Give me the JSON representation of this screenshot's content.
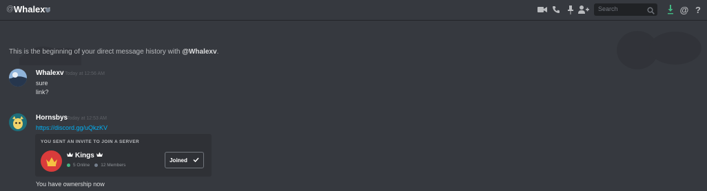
{
  "header": {
    "title": "Whalexv",
    "search_placeholder": "Search",
    "icons": [
      "at-icon",
      "video-call-icon",
      "voice-call-icon",
      "pin-icon",
      "add-friend-icon",
      "search-icon",
      "download-icon",
      "mentions-icon",
      "help-icon"
    ]
  },
  "intro": {
    "text_before": "This is the beginning of your direct message history with ",
    "mention": "@Whalexv",
    "text_after": "."
  },
  "messages": [
    {
      "author": "Whalexv",
      "timestamp": "Today at 12:56 AM",
      "lines": [
        "sure",
        "link?"
      ]
    },
    {
      "author": "Hornsbys",
      "timestamp": "Today at 12:53 AM",
      "link": "https://discord.gg/uQkzKV",
      "invite": {
        "header": "YOU SENT AN INVITE TO JOIN A SERVER",
        "guild_name": "Kings",
        "online": "5 Online",
        "members": "12 Members",
        "button_label": "Joined"
      },
      "after_text": "You have ownership now"
    }
  ],
  "colors": {
    "background": "#36393f",
    "link": "#00b0f4",
    "online": "#43b581",
    "members": "#747f8d",
    "guild_icon": "#d93b3b"
  }
}
